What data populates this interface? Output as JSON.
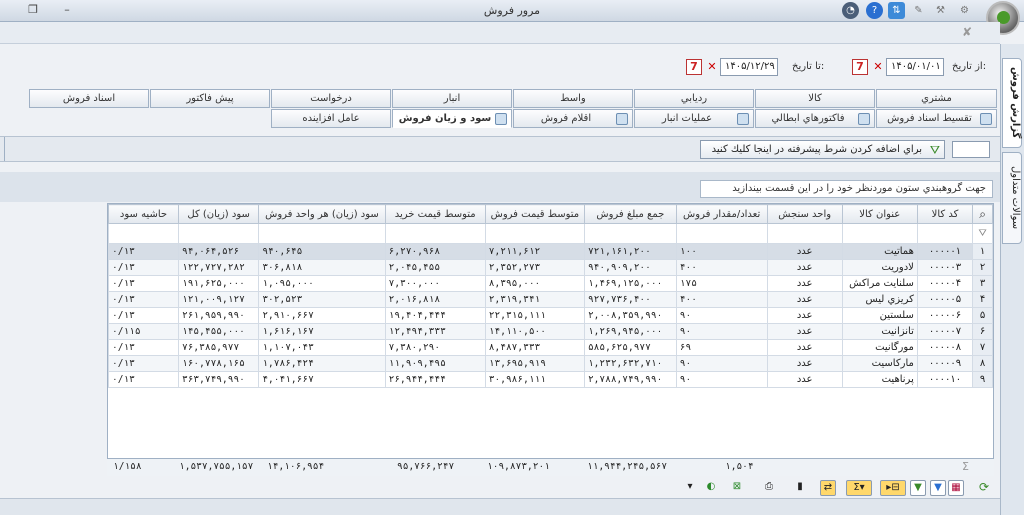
{
  "window": {
    "title": "مرور فروش"
  },
  "filter": {
    "from_label": "از تاريخ:",
    "from_value": "۱۴۰۵/۰۱/۰۱",
    "to_label": "تا تاريخ:",
    "to_value": "۱۴۰۵/۱۲/۲۹"
  },
  "side_tabs": [
    "گزارش فروش",
    "سوالات متداول"
  ],
  "tabs_row1": [
    "مشتري",
    "كالا",
    "رديابي",
    "واسط",
    "انبار",
    "درخواست",
    "پيش فاكتور",
    "اسناد فروش"
  ],
  "tabs_row2": [
    "تقسيط اسناد فروش",
    "فاكتورهاي ابطالي",
    "عمليات انبار",
    "اقلام فروش",
    "سود و زيان فروش",
    "عامل افزاينده"
  ],
  "selected_tab": "سود و زيان فروش",
  "advanced_filter_label": "براي اضافه كردن شرط پيشرفته در اينجا كليك كنيد",
  "group_hint": "جهت گروهبندي ستون موردنظر خود را در اين قسمت بيندازيد",
  "columns": [
    "كد كالا",
    "عنوان كالا",
    "واحد سنجش",
    "تعداد/مقدار فروش",
    "جمع مبلغ فروش",
    "متوسط قيمت فروش",
    "متوسط قيمت خريد",
    "سود (زيان) هر واحد فروش",
    "سود (زيان) كل",
    "حاشيه سود"
  ],
  "rows": [
    {
      "idx": "۱",
      "code": "۰۰۰۰۰۱",
      "name": "هماتيت",
      "unit": "عدد",
      "qty": "۱۰۰",
      "total": "۷۲۱,۱۶۱,۲۰۰",
      "avg_sell": "۷,۲۱۱,۶۱۲",
      "avg_buy": "۶,۲۷۰,۹۶۸",
      "unit_profit": "۹۴۰,۶۴۵",
      "total_profit": "۹۴,۰۶۴,۵۲۶",
      "margin": "۰/۱۳"
    },
    {
      "idx": "۲",
      "code": "۰۰۰۰۰۳",
      "name": "لادوريت",
      "unit": "عدد",
      "qty": "۴۰۰",
      "total": "۹۴۰,۹۰۹,۲۰۰",
      "avg_sell": "۲,۳۵۲,۲۷۳",
      "avg_buy": "۲,۰۴۵,۴۵۵",
      "unit_profit": "۳۰۶,۸۱۸",
      "total_profit": "۱۲۲,۷۲۷,۲۸۲",
      "margin": "۰/۱۳"
    },
    {
      "idx": "۳",
      "code": "۰۰۰۰۰۴",
      "name": "سلنايت مراكش",
      "unit": "عدد",
      "qty": "۱۷۵",
      "total": "۱,۴۶۹,۱۲۵,۰۰۰",
      "avg_sell": "۸,۳۹۵,۰۰۰",
      "avg_buy": "۷,۳۰۰,۰۰۰",
      "unit_profit": "۱,۰۹۵,۰۰۰",
      "total_profit": "۱۹۱,۶۲۵,۰۰۰",
      "margin": "۰/۱۳"
    },
    {
      "idx": "۴",
      "code": "۰۰۰۰۰۵",
      "name": "كريزي ليس",
      "unit": "عدد",
      "qty": "۴۰۰",
      "total": "۹۲۷,۷۳۶,۴۰۰",
      "avg_sell": "۲,۳۱۹,۳۴۱",
      "avg_buy": "۲,۰۱۶,۸۱۸",
      "unit_profit": "۳۰۲,۵۲۳",
      "total_profit": "۱۲۱,۰۰۹,۱۲۷",
      "margin": "۰/۱۳"
    },
    {
      "idx": "۵",
      "code": "۰۰۰۰۰۶",
      "name": "سلستين",
      "unit": "عدد",
      "qty": "۹۰",
      "total": "۲,۰۰۸,۳۵۹,۹۹۰",
      "avg_sell": "۲۲,۳۱۵,۱۱۱",
      "avg_buy": "۱۹,۴۰۴,۴۴۴",
      "unit_profit": "۲,۹۱۰,۶۶۷",
      "total_profit": "۲۶۱,۹۵۹,۹۹۰",
      "margin": "۰/۱۳"
    },
    {
      "idx": "۶",
      "code": "۰۰۰۰۰۷",
      "name": "تانزانيت",
      "unit": "عدد",
      "qty": "۹۰",
      "total": "۱,۲۶۹,۹۴۵,۰۰۰",
      "avg_sell": "۱۴,۱۱۰,۵۰۰",
      "avg_buy": "۱۲,۴۹۴,۳۳۳",
      "unit_profit": "۱,۶۱۶,۱۶۷",
      "total_profit": "۱۴۵,۴۵۵,۰۰۰",
      "margin": "۰/۱۱۵"
    },
    {
      "idx": "۷",
      "code": "۰۰۰۰۰۸",
      "name": "مورگانيت",
      "unit": "عدد",
      "qty": "۶۹",
      "total": "۵۸۵,۶۲۵,۹۷۷",
      "avg_sell": "۸,۴۸۷,۳۳۳",
      "avg_buy": "۷,۳۸۰,۲۹۰",
      "unit_profit": "۱,۱۰۷,۰۴۳",
      "total_profit": "۷۶,۳۸۵,۹۷۷",
      "margin": "۰/۱۳"
    },
    {
      "idx": "۸",
      "code": "۰۰۰۰۰۹",
      "name": "ماركاسيت",
      "unit": "عدد",
      "qty": "۹۰",
      "total": "۱,۲۳۲,۶۳۲,۷۱۰",
      "avg_sell": "۱۳,۶۹۵,۹۱۹",
      "avg_buy": "۱۱,۹۰۹,۴۹۵",
      "unit_profit": "۱,۷۸۶,۴۲۴",
      "total_profit": "۱۶۰,۷۷۸,۱۶۵",
      "margin": "۰/۱۳"
    },
    {
      "idx": "۹",
      "code": "۰۰۰۰۱۰",
      "name": "پرناهيت",
      "unit": "عدد",
      "qty": "۹۰",
      "total": "۲,۷۸۸,۷۴۹,۹۹۰",
      "avg_sell": "۳۰,۹۸۶,۱۱۱",
      "avg_buy": "۲۶,۹۴۴,۴۴۴",
      "unit_profit": "۴,۰۴۱,۶۶۷",
      "total_profit": "۳۶۳,۷۴۹,۹۹۰",
      "margin": "۰/۱۳"
    }
  ],
  "totals": {
    "qty": "۱,۵۰۴",
    "total": "۱۱,۹۴۴,۲۴۵,۵۶۷",
    "avg_sell": "۱۰۹,۸۷۳,۲۰۱",
    "avg_buy": "۹۵,۷۶۶,۲۴۷",
    "unit_profit": "۱۴,۱۰۶,۹۵۴",
    "total_profit": "۱,۵۳۷,۷۵۵,۱۵۷",
    "margin": "۱/۱۵۸"
  },
  "colors": {
    "accent": "#6d8fb3",
    "selected_row": "#d6dde6",
    "header": "#e3e8ee"
  }
}
